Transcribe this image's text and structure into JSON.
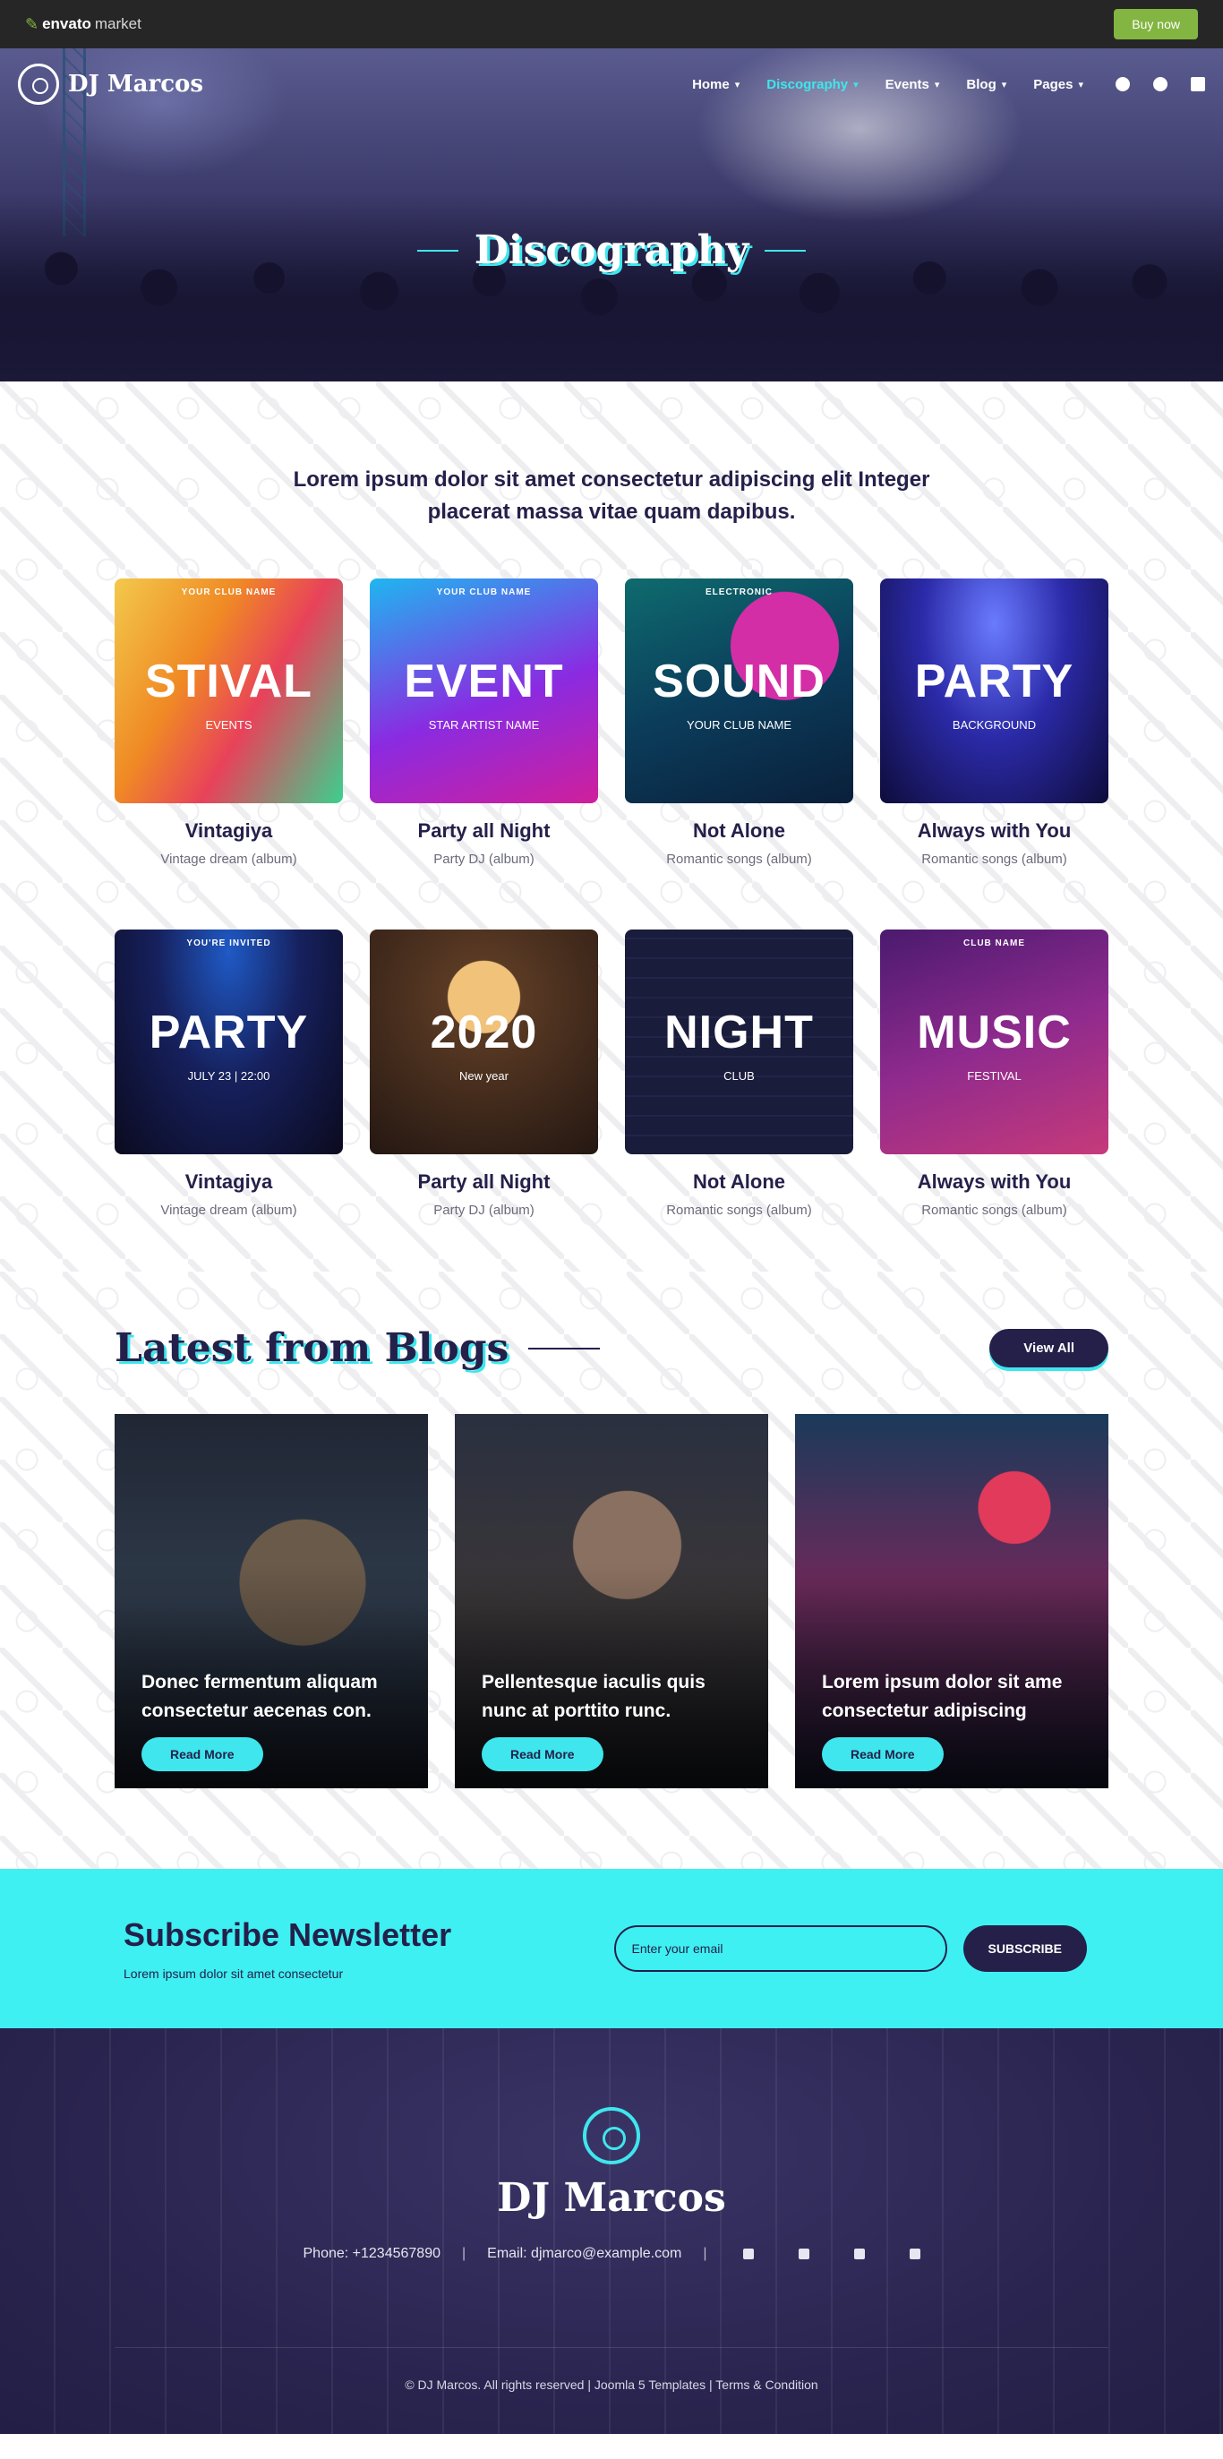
{
  "envato": {
    "logo_brand": "envato",
    "logo_market": "market",
    "buy_label": "Buy now"
  },
  "site": {
    "name": "DJ Marcos"
  },
  "nav": {
    "items": [
      {
        "label": "Home",
        "active": false
      },
      {
        "label": "Discography",
        "active": true
      },
      {
        "label": "Events",
        "active": false
      },
      {
        "label": "Blog",
        "active": false
      },
      {
        "label": "Pages",
        "active": false
      }
    ],
    "social": [
      "facebook-icon",
      "pinterest-icon",
      "linkedin-icon"
    ]
  },
  "hero": {
    "title": "Discography"
  },
  "intro": "Lorem ipsum dolor sit amet consectetur adipiscing elit Integer placerat massa vitae quam dapibus.",
  "albums": [
    {
      "title": "Vintagiya",
      "subtitle": "Vintage dream (album)",
      "cover": {
        "top": "YOUR CLUB NAME",
        "big": "STIVAL",
        "sub": "EVENTS"
      }
    },
    {
      "title": "Party all Night",
      "subtitle": "Party DJ (album)",
      "cover": {
        "top": "YOUR CLUB NAME",
        "big": "EVENT",
        "sub": "STAR ARTIST NAME"
      }
    },
    {
      "title": "Not Alone",
      "subtitle": "Romantic songs (album)",
      "cover": {
        "top": "ELECTRONIC",
        "big": "SOUND",
        "sub": "YOUR CLUB NAME"
      }
    },
    {
      "title": "Always with You",
      "subtitle": "Romantic songs (album)",
      "cover": {
        "top": "",
        "big": "PARTY",
        "sub": "BACKGROUND"
      }
    },
    {
      "title": "Vintagiya",
      "subtitle": "Vintage dream (album)",
      "cover": {
        "top": "YOU'RE INVITED",
        "big": "PARTY",
        "sub": "JULY 23 | 22:00"
      }
    },
    {
      "title": "Party all Night",
      "subtitle": "Party DJ (album)",
      "cover": {
        "top": "",
        "big": "2020",
        "sub": "New year"
      }
    },
    {
      "title": "Not Alone",
      "subtitle": "Romantic songs (album)",
      "cover": {
        "top": "",
        "big": "NIGHT",
        "sub": "CLUB"
      }
    },
    {
      "title": "Always with You",
      "subtitle": "Romantic songs (album)",
      "cover": {
        "top": "CLUB NAME",
        "big": "MUSIC",
        "sub": "FESTIVAL"
      }
    }
  ],
  "blogs": {
    "title": "Latest from Blogs",
    "view_all": "View All",
    "read_more": "Read More",
    "posts": [
      {
        "title": "Donec fermentum aliquam consectetur aecenas con."
      },
      {
        "title": "Pellentesque iaculis quis nunc at porttito runc."
      },
      {
        "title": "Lorem ipsum dolor sit ame consectetur adipiscing"
      }
    ]
  },
  "newsletter": {
    "title": "Subscribe Newsletter",
    "subtitle": "Lorem ipsum dolor sit amet consectetur",
    "placeholder": "Enter your email",
    "button": "SUBSCRIBE"
  },
  "footer": {
    "name": "DJ Marcos",
    "phone": "Phone: +1234567890",
    "email": "Email: djmarco@example.com",
    "separator": "|",
    "social": [
      "facebook-icon",
      "twitter-icon",
      "linkedin-icon",
      "instagram-icon"
    ],
    "copyright": "© DJ Marcos. All rights reserved | Joomla 5 Templates | Terms & Condition"
  },
  "colors": {
    "accent": "#3fe6ed",
    "dark": "#24204a",
    "envato_green": "#82b541"
  }
}
